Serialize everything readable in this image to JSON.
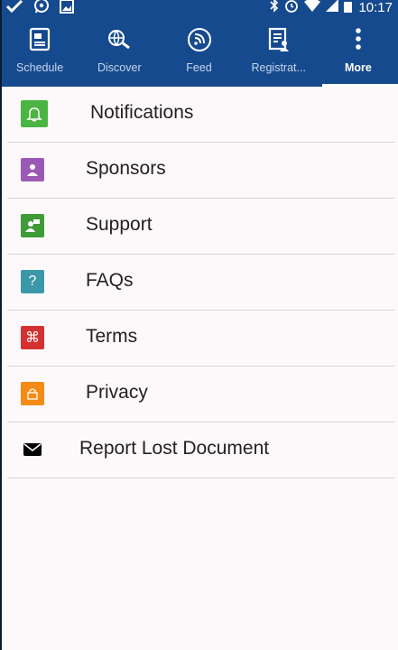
{
  "status_bar": {
    "time": "10:17",
    "left_icons": [
      "check-icon",
      "whatsapp-icon",
      "image-icon"
    ],
    "right_icons": [
      "bluetooth-icon",
      "alarm-icon",
      "wifi-icon",
      "signal-icon",
      "battery-icon"
    ]
  },
  "tabs": [
    {
      "label": "Schedule",
      "icon": "schedule-icon",
      "active": false
    },
    {
      "label": "Discover",
      "icon": "globe-search-icon",
      "active": false
    },
    {
      "label": "Feed",
      "icon": "rss-icon",
      "active": false
    },
    {
      "label": "Registrat...",
      "icon": "registration-icon",
      "active": false
    },
    {
      "label": "More",
      "icon": "more-vertical-icon",
      "active": true
    }
  ],
  "menu": [
    {
      "label": "Notifications",
      "icon": "bell-icon",
      "color": "#4bb543"
    },
    {
      "label": "Sponsors",
      "icon": "sponsor-icon",
      "color": "#9b59b6"
    },
    {
      "label": "Support",
      "icon": "support-icon",
      "color": "#3e9b37"
    },
    {
      "label": "FAQs",
      "icon": "question-icon",
      "color": "#3a98a8",
      "glyph": "?"
    },
    {
      "label": "Terms",
      "icon": "command-icon",
      "color": "#d63131",
      "glyph": "⌘"
    },
    {
      "label": "Privacy",
      "icon": "lock-icon",
      "color": "#f38b16"
    },
    {
      "label": "Report Lost Document",
      "icon": "envelope-icon",
      "color": "#000000"
    }
  ],
  "colors": {
    "app_bar": "#164a8e",
    "background": "#fdf9fb",
    "divider": "#d8d4d6"
  }
}
